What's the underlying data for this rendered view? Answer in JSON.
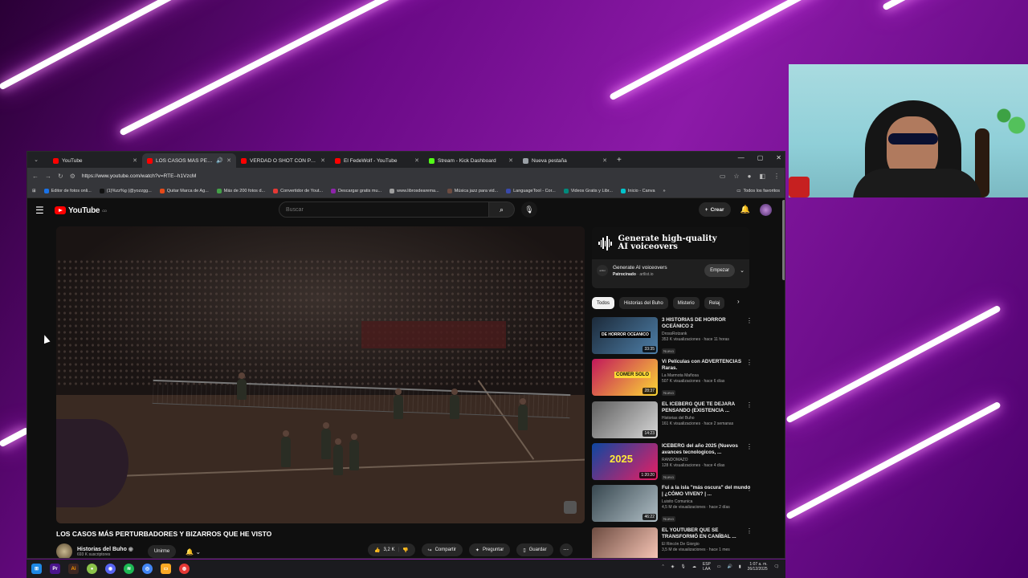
{
  "browser": {
    "tabs": [
      {
        "title": "YouTube",
        "favicon_color": "#ff0000"
      },
      {
        "title": "LOS CASOS MÁS PERTURBA",
        "favicon_color": "#ff0000",
        "active": true
      },
      {
        "title": "VERDAD O SHOT CON PADRES",
        "favicon_color": "#ff0000"
      },
      {
        "title": "El FedeWolf - YouTube",
        "favicon_color": "#ff0000"
      },
      {
        "title": "Stream - Kick Dashboard",
        "favicon_color": "#53fc18"
      },
      {
        "title": "Nueva pestaña",
        "favicon_color": "#9aa0a6"
      }
    ],
    "url": "https://www.youtube.com/watch?v=RTE--h1VzcM",
    "bookmarks": [
      {
        "label": "Editor de fotos onli...",
        "color": "#1a73e8"
      },
      {
        "label": "(1)%zz%g (@yozzgg...",
        "color": "#111111"
      },
      {
        "label": "Quitar Marca de Ag...",
        "color": "#e64a19"
      },
      {
        "label": "Más de 200 fotos d...",
        "color": "#43a047"
      },
      {
        "label": "Convertidor de Yout...",
        "color": "#e53935"
      },
      {
        "label": "Descargar gratis mu...",
        "color": "#8e24aa"
      },
      {
        "label": "www.librosdearema...",
        "color": "#9e9e9e"
      },
      {
        "label": "Música jazz para vid...",
        "color": "#6d4c41"
      },
      {
        "label": "LanguageTool - Cor...",
        "color": "#3949ab"
      },
      {
        "label": "Videos Gratis y Libr...",
        "color": "#00897b"
      },
      {
        "label": "Inicio - Canva",
        "color": "#00c4cc"
      }
    ],
    "all_bookmarks": "Todos los favoritos"
  },
  "youtube": {
    "logo": "YouTube",
    "logo_country": "CO",
    "search_placeholder": "Buscar",
    "create_label": "Crear",
    "video": {
      "title": "LOS CASOS MÁS PERTURBADORES Y BIZARROS QUE HE VISTO",
      "channel": "Historias del Buho",
      "subscribers": "693 K suscriptores",
      "join_label": "Unirme",
      "likes": "3,2 K",
      "share_label": "Compartir",
      "ask_label": "Preguntar",
      "save_label": "Guardar"
    },
    "ad": {
      "headline_1": "Generate high-quality",
      "headline_2": "AI voiceovers",
      "name": "Generate AI voiceovers",
      "sponsored": "Patrocinado",
      "domain": "· artlist.io",
      "cta": "Empezar"
    },
    "chips": [
      "Todos",
      "Historias del Buho",
      "Misterio",
      "Relaj"
    ],
    "recommendations": [
      {
        "title": "3 HISTORIAS DE HORROR OCEÁNICO 2",
        "channel": "DrossRotzank",
        "meta": "353 K visualizaciones · hace 11 horas",
        "badge": "Nuevo",
        "duration": "33:35",
        "color1": "#1c2a3a",
        "color2": "#4e7fa8",
        "thumb_text": "DE HORROR OCEANICO"
      },
      {
        "title": "Vi Películas con ADVERTENCIAS Raras.",
        "channel": "La Marmota Mañosa",
        "meta": "507 K visualizaciones · hace 6 días",
        "badge": "Nuevo",
        "duration": "28:37",
        "color1": "#c2185b",
        "color2": "#fdd835",
        "thumb_text": "COMER SOLO"
      },
      {
        "title": "EL ICEBERG QUE TE DEJARÁ PENSANDO (EXISTENCIA ...",
        "channel": "Historias del Buho",
        "meta": "161 K visualizaciones · hace 2 semanas",
        "badge": "",
        "duration": "14:23",
        "color1": "#5e5e5e",
        "color2": "#d7d7d7",
        "thumb_text": ""
      },
      {
        "title": "ICEBERG del año 2025 (Nuevos avances tecnologicos, ...",
        "channel": "RANDOMAZO",
        "meta": "128 K visualizaciones · hace 4 días",
        "badge": "Nuevo",
        "duration": "1:20:20",
        "color1": "#0d47a1",
        "color2": "#e91e63",
        "thumb_text": "2025"
      },
      {
        "title": "Fui a la isla \"más oscura\" del mundo | ¿CÓMO VIVEN? | ...",
        "channel": "Luisito Comunica",
        "meta": "4,5 M de visualizaciones · hace 2 días",
        "badge": "Nuevo",
        "duration": "46:22",
        "color1": "#37474f",
        "color2": "#b0bec5",
        "thumb_text": ""
      },
      {
        "title": "EL YOUTUBER QUE SE TRANSFORMÓ EN CANÍBAL ...",
        "channel": "El Rincón De Giorgio",
        "meta": "3,5 M de visualizaciones · hace 1 mes",
        "badge": "",
        "duration": "",
        "color1": "#6d4c41",
        "color2": "#ffccbc",
        "thumb_text": ""
      }
    ]
  },
  "taskbar": {
    "lang_1": "ESP",
    "lang_2": "LAA",
    "time": "1:07 a. m.",
    "date": "26/12/2025"
  }
}
